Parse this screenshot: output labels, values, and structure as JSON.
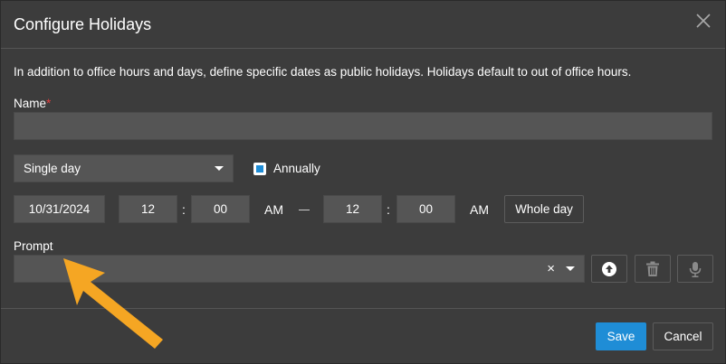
{
  "dialog": {
    "title": "Configure Holidays",
    "description": "In addition to office hours and days, define specific dates as public holidays. Holidays default to out of office hours."
  },
  "name_field": {
    "label": "Name",
    "required_mark": "*",
    "value": ""
  },
  "duration_select": {
    "selected": "Single day"
  },
  "annually": {
    "label": "Annually",
    "checked": true
  },
  "time": {
    "date": "10/31/2024",
    "start_hour": "12",
    "start_minute": "00",
    "start_ampm": "AM",
    "end_hour": "12",
    "end_minute": "00",
    "end_ampm": "AM",
    "separator": ":",
    "whole_day_label": "Whole day"
  },
  "prompt": {
    "label": "Prompt",
    "value": "",
    "clear_glyph": "×"
  },
  "footer": {
    "save_label": "Save",
    "cancel_label": "Cancel"
  },
  "colors": {
    "accent": "#1f8dd6",
    "background": "#3c3c3c",
    "field": "#555555",
    "annotation": "#f5a623"
  },
  "icons": [
    "close-icon",
    "chevron-down-icon",
    "upload-icon",
    "trash-icon",
    "microphone-icon",
    "arrow-annotation"
  ]
}
